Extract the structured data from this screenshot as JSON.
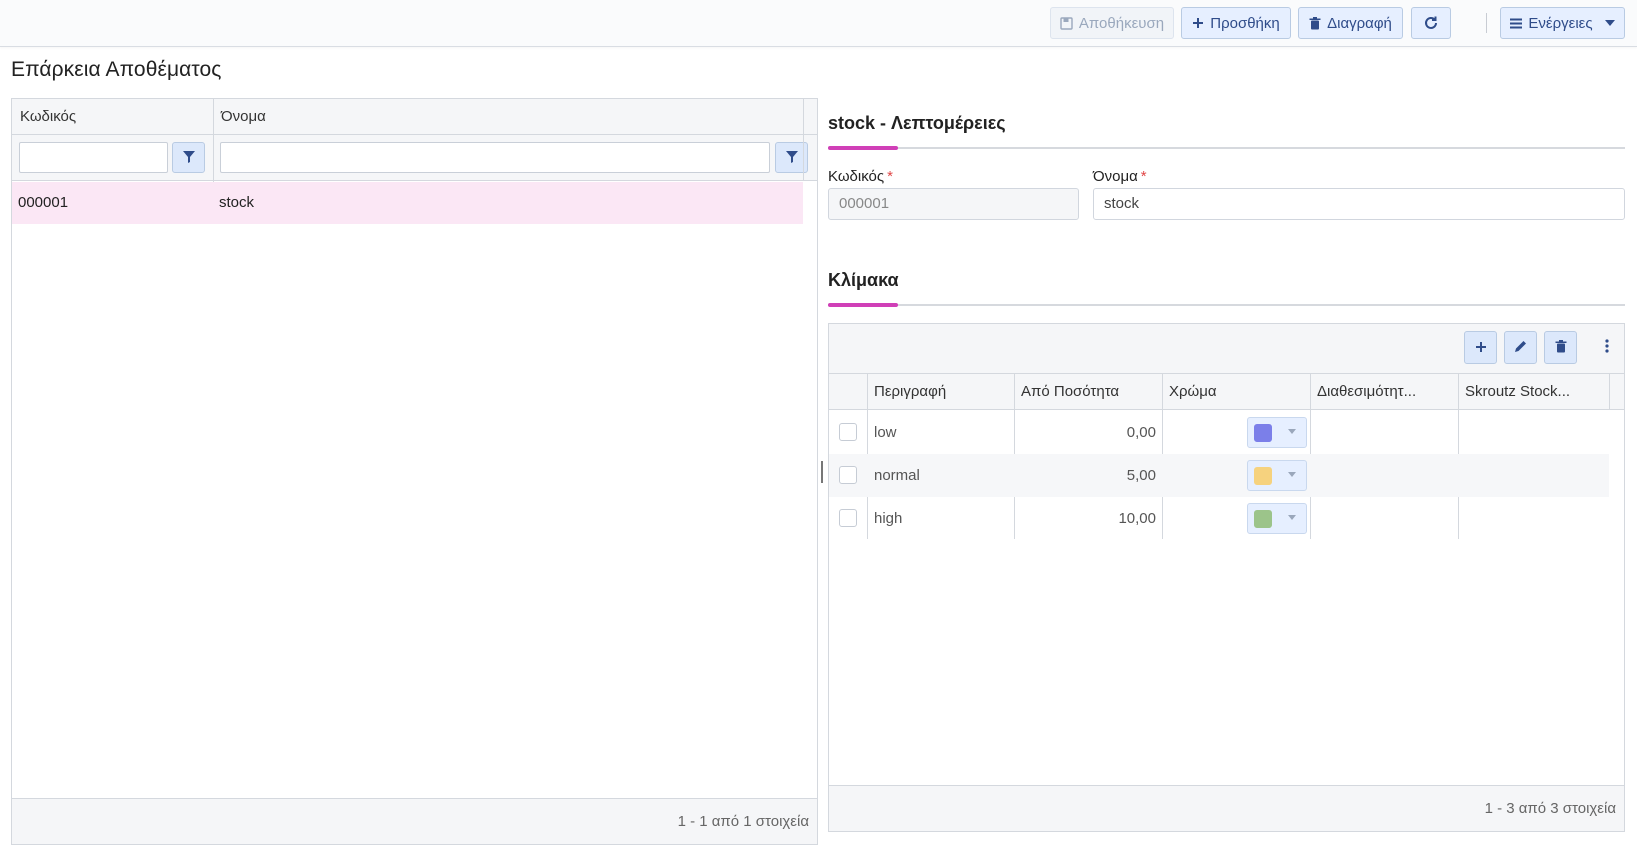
{
  "toolbar": {
    "save_label": "Αποθήκευση",
    "add_label": "Προσθήκη",
    "delete_label": "Διαγραφή",
    "actions_label": "Ενέργειες"
  },
  "page": {
    "title": "Επάρκεια Αποθέματος"
  },
  "list_grid": {
    "columns": [
      "Κωδικός",
      "Όνομα"
    ],
    "rows": [
      {
        "code": "000001",
        "name": "stock"
      }
    ],
    "footer": "1 - 1 από 1 στοιχεία"
  },
  "details": {
    "title": "stock - Λεπτομέρειες",
    "code_label": "Κωδικός",
    "code_value": "000001",
    "name_label": "Όνομα",
    "name_value": "stock",
    "required_mark": "*"
  },
  "scale": {
    "title": "Κλίμακα",
    "columns": [
      "Περιγραφή",
      "Από Ποσότητα",
      "Χρώμα",
      "Διαθεσιμότητ...",
      "Skroutz Stock..."
    ],
    "rows": [
      {
        "description": "low",
        "from_qty": "0,00",
        "color": "#7b7fe9",
        "availability": "",
        "skroutz": ""
      },
      {
        "description": "normal",
        "from_qty": "5,00",
        "color": "#f6d27e",
        "availability": "",
        "skroutz": ""
      },
      {
        "description": "high",
        "from_qty": "10,00",
        "color": "#9cc48a",
        "availability": "",
        "skroutz": ""
      }
    ],
    "footer": "1 - 3 από 3 στοιχεία"
  },
  "colors": {
    "accent": "#d03fb7",
    "selected_row": "#fbe7f5",
    "button_bg": "#e6efff",
    "button_text": "#2f4c8a"
  }
}
